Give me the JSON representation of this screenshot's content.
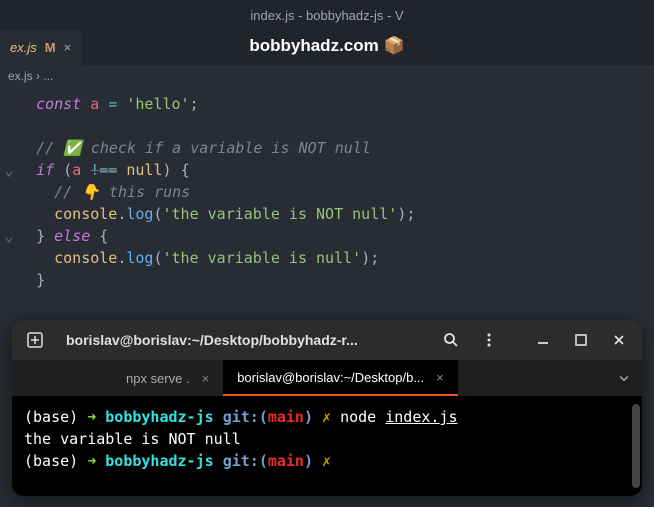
{
  "window": {
    "title": "index.js - bobbyhadz-js - V"
  },
  "editor_tab": {
    "filename": "ex.js",
    "modified_indicator": "M",
    "close": "×"
  },
  "brand": {
    "text": "bobbyhadz.com 📦"
  },
  "breadcrumb": {
    "path": "ex.js › ..."
  },
  "code": {
    "l1": {
      "kw": "const",
      "var": "a",
      "op": "=",
      "str": "'hello'",
      "semi": ";"
    },
    "l3": {
      "cmt": "// ✅ check if a variable is NOT null"
    },
    "l4": {
      "kw": "if",
      "p1": "(",
      "var": "a",
      "op": "!==",
      "null": "null",
      "p2": ")",
      "b": "{"
    },
    "l5": {
      "cmt": "// 👇 this runs"
    },
    "l6": {
      "obj": "console",
      "dot": ".",
      "fn": "log",
      "p1": "(",
      "str": "'the variable is NOT null'",
      "p2": ")",
      "semi": ";"
    },
    "l7": {
      "b1": "}",
      "kw": "else",
      "b2": "{"
    },
    "l8": {
      "obj": "console",
      "dot": ".",
      "fn": "log",
      "p1": "(",
      "str": "'the variable is null'",
      "p2": ")",
      "semi": ";"
    },
    "l9": {
      "b": "}"
    }
  },
  "terminal": {
    "header_title": "borislav@borislav:~/Desktop/bobbyhadz-r...",
    "tabs": [
      {
        "label": "npx serve .",
        "active": false
      },
      {
        "label": "borislav@borislav:~/Desktop/b...",
        "active": true
      }
    ],
    "lines": {
      "p1": {
        "base": "(base)",
        "arrow": "➜",
        "dir": "bobbyhadz-js",
        "git": "git:",
        "lp": "(",
        "branch": "main",
        "rp": ")",
        "x": "✗",
        "cmd": "node",
        "file": "index.js"
      },
      "out": "the variable is NOT null",
      "p2": {
        "base": "(base)",
        "arrow": "➜",
        "dir": "bobbyhadz-js",
        "git": "git:",
        "lp": "(",
        "branch": "main",
        "rp": ")",
        "x": "✗"
      }
    }
  }
}
